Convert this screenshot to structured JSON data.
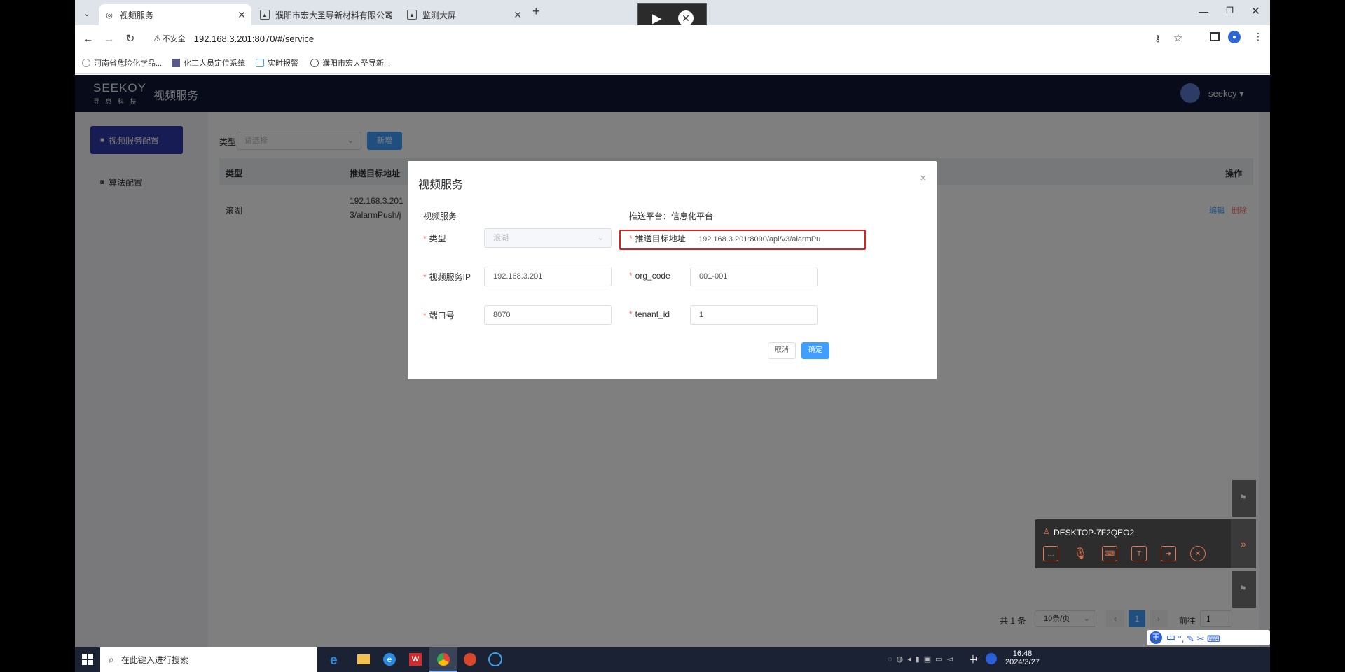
{
  "browser": {
    "tabs": [
      {
        "title": "视频服务",
        "active": true
      },
      {
        "title": "濮阳市宏大圣导新材料有限公司",
        "active": false
      },
      {
        "title": "监测大屏",
        "active": false
      }
    ],
    "new_tab": "+",
    "security_label": "不安全",
    "url": "192.168.3.201:8070/#/service",
    "bookmarks": [
      "河南省危险化学品...",
      "化工人员定位系统",
      "实时报警",
      "濮阳市宏大圣导新..."
    ]
  },
  "app": {
    "logo": "SEEKOY",
    "logo_sub": "寻 息 科 技",
    "title": "视频服务",
    "user": "seekcy",
    "sidebar": [
      {
        "label": "视频服务配置",
        "active": true
      },
      {
        "label": "算法配置",
        "active": false
      }
    ],
    "filter": {
      "type_label": "类型",
      "type_placeholder": "请选择",
      "add_button": "新增"
    },
    "table": {
      "columns": [
        "类型",
        "推送目标地址",
        "操作"
      ],
      "rows": [
        {
          "type": "滚湖",
          "target_line1": "192.168.3.201",
          "target_line2": "3/alarmPush/j",
          "edit": "编辑",
          "delete": "删除"
        }
      ]
    },
    "pagination": {
      "total": "共 1 条",
      "page_size": "10条/页",
      "prev": "‹",
      "current": "1",
      "next": "›",
      "goto": "前往",
      "goto_value": "1"
    }
  },
  "dialog": {
    "title": "视频服务",
    "close": "×",
    "left_section": "视频服务",
    "right_section": "推送平台：信息化平台",
    "fields": {
      "type": {
        "label": "类型",
        "value": "滚湖"
      },
      "ip": {
        "label": "视频服务IP",
        "value": "192.168.3.201"
      },
      "port": {
        "label": "端口号",
        "value": "8070"
      },
      "target": {
        "label": "推送目标地址",
        "value": "192.168.3.201:8090/api/v3/alarmPu"
      },
      "org_code": {
        "label": "org_code",
        "value": "001-001"
      },
      "tenant_id": {
        "label": "tenant_id",
        "value": "1"
      }
    },
    "cancel": "取消",
    "confirm": "确定"
  },
  "remote": {
    "device": "DESKTOP-7F2QEO2"
  },
  "taskbar": {
    "search_placeholder": "在此键入进行搜索",
    "time": "16:48",
    "date": "2024/3/27",
    "ime": "中",
    "ime_bar": "中 °, ✎ ✂ ⌨"
  },
  "colors": {
    "header": "#101733",
    "primary": "#409eff",
    "sidebar_active": "#2f3aa8",
    "highlight": "#e02020",
    "danger": "#f56c6c"
  }
}
